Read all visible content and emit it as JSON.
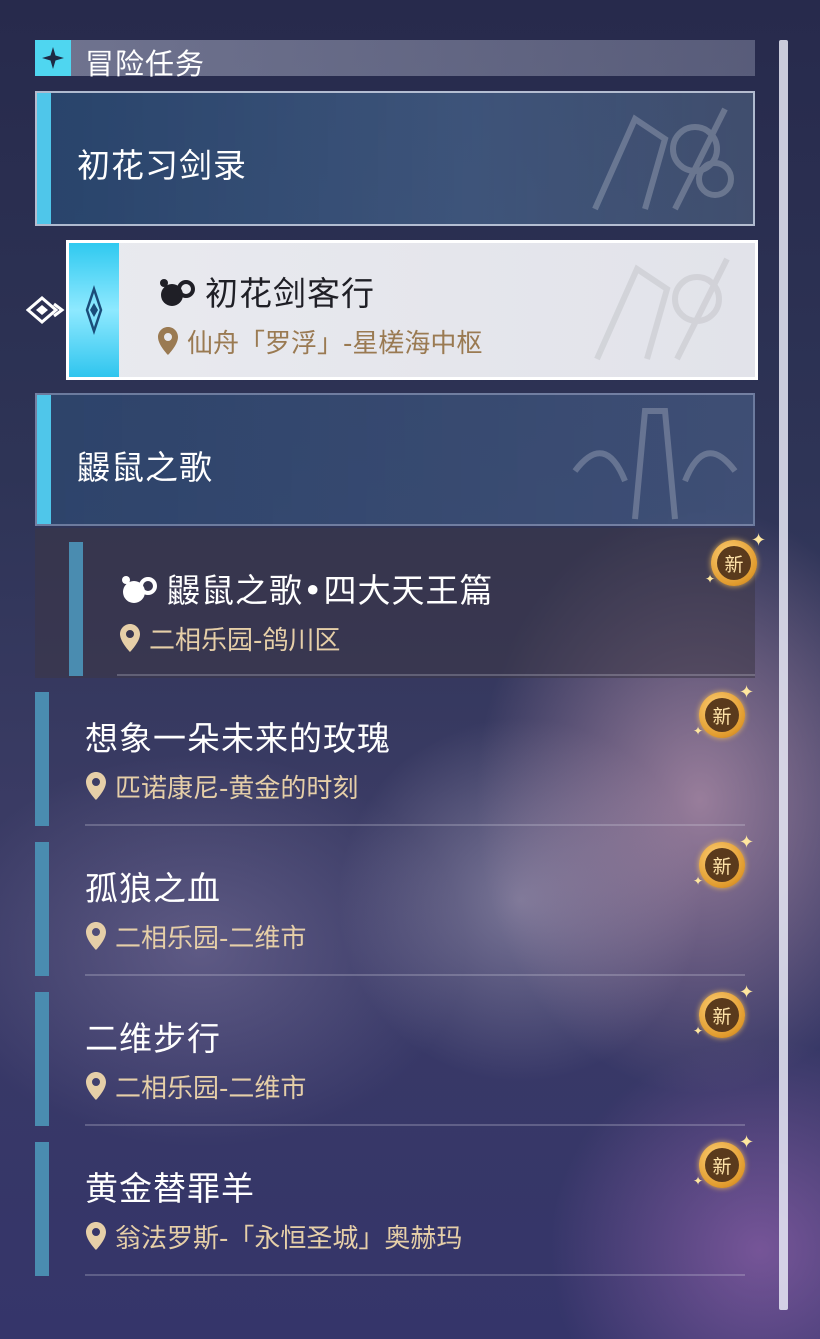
{
  "header": {
    "title": "冒险任务"
  },
  "categories": [
    {
      "title": "初花习剑录"
    },
    {
      "title": "鼹鼠之歌"
    }
  ],
  "selected_quest": {
    "name": "初花剑客行",
    "location": "仙舟「罗浮」-星槎海中枢"
  },
  "sub_quest": {
    "name": "鼹鼠之歌•四大天王篇",
    "location": "二相乐园-鸽川区",
    "badge": "新"
  },
  "quests": [
    {
      "name": "想象一朵未来的玫瑰",
      "location": "匹诺康尼-黄金的时刻",
      "badge": "新"
    },
    {
      "name": "孤狼之血",
      "location": "二相乐园-二维市",
      "badge": "新"
    },
    {
      "name": "二维步行",
      "location": "二相乐园-二维市",
      "badge": "新"
    },
    {
      "name": "黄金替罪羊",
      "location": "翁法罗斯-「永恒圣城」奥赫玛",
      "badge": "新"
    }
  ],
  "colors": {
    "accent": "#4fc6ea",
    "location_text": "#e6cfa8",
    "badge": "#e09a2c"
  }
}
